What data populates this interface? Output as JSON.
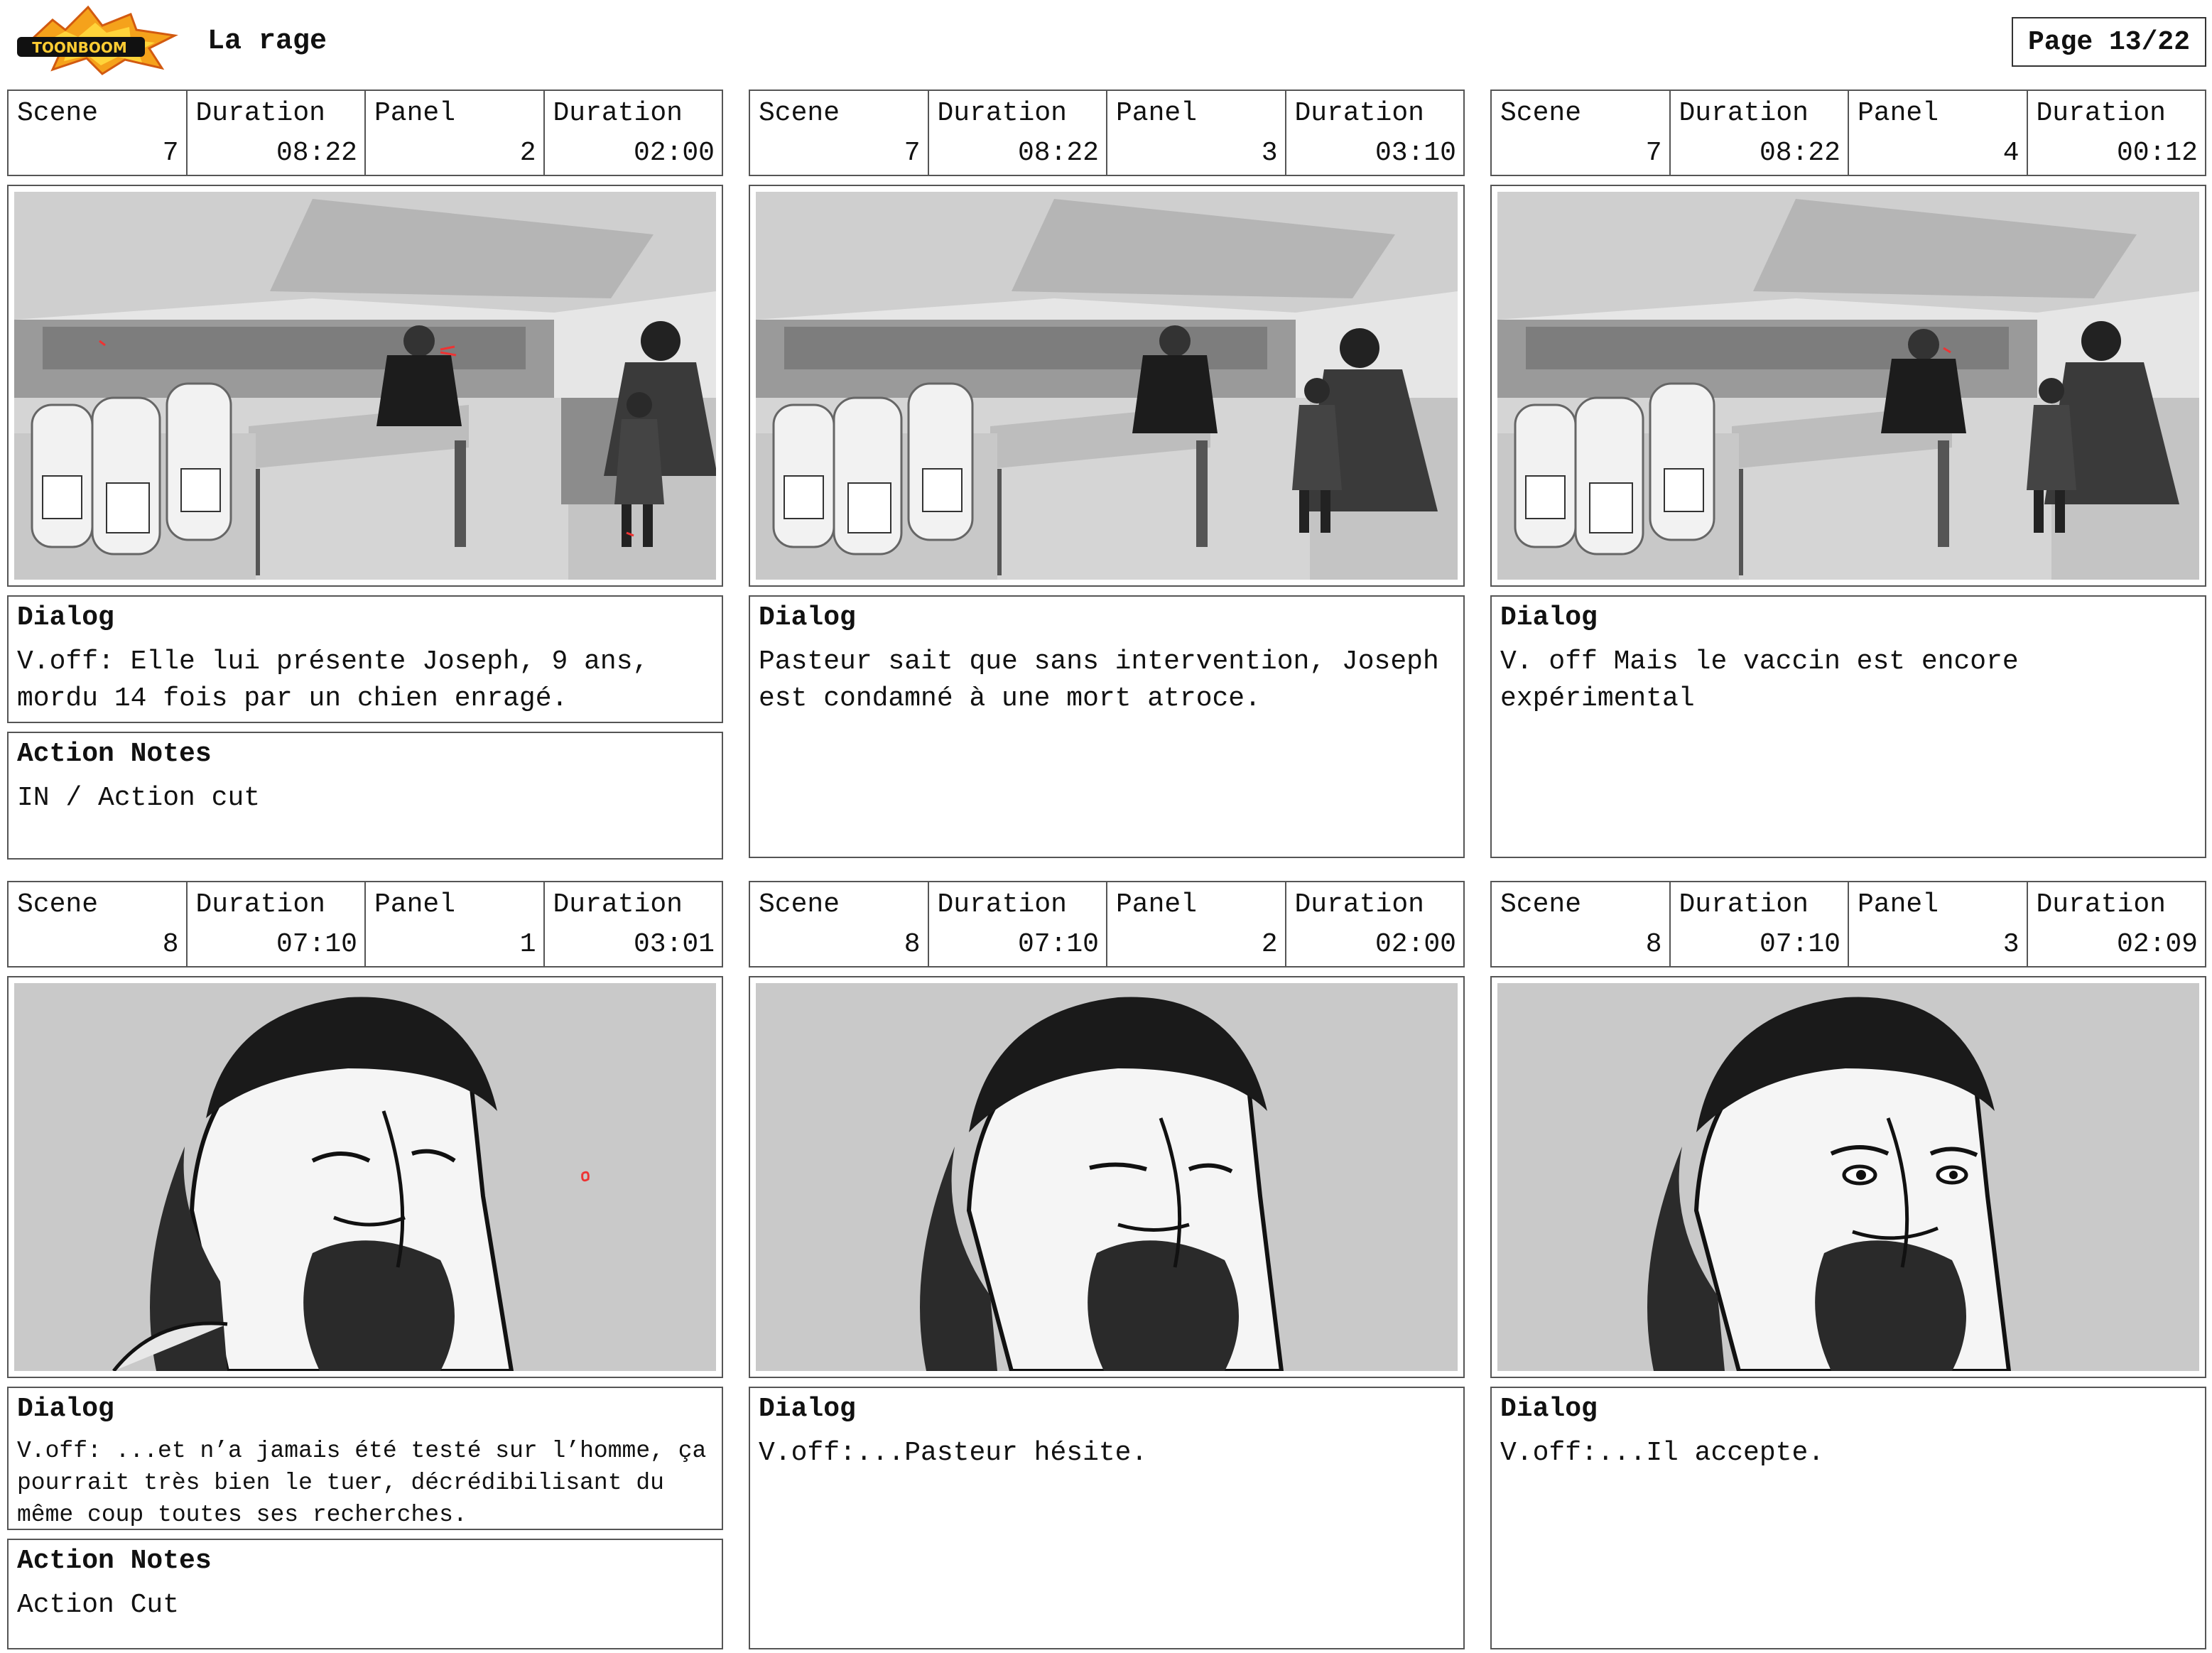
{
  "header": {
    "logo_text": "TOONBOOM",
    "title": "La rage",
    "page_label": "Page 13/22"
  },
  "labels": {
    "scene": "Scene",
    "duration": "Duration",
    "panel": "Panel",
    "dialog": "Dialog",
    "action_notes": "Action Notes"
  },
  "panels": [
    {
      "scene": "7",
      "scene_duration": "08:22",
      "panel": "2",
      "panel_duration": "02:00",
      "dialog": "V.off: Elle lui présente Joseph, 9 ans, mordu 14 fois par un chien enragé.",
      "action_notes": "IN / Action cut"
    },
    {
      "scene": "7",
      "scene_duration": "08:22",
      "panel": "3",
      "panel_duration": "03:10",
      "dialog": "Pasteur sait que sans intervention, Joseph est condamné à une mort atroce."
    },
    {
      "scene": "7",
      "scene_duration": "08:22",
      "panel": "4",
      "panel_duration": "00:12",
      "dialog": "V. off Mais le vaccin est encore expérimental"
    },
    {
      "scene": "8",
      "scene_duration": "07:10",
      "panel": "1",
      "panel_duration": "03:01",
      "dialog": "V.off: ...et n’a jamais été testé sur l’homme, ça pourrait très bien le tuer, décrédibilisant du même coup toutes ses recherches.",
      "action_notes": "Action Cut"
    },
    {
      "scene": "8",
      "scene_duration": "07:10",
      "panel": "2",
      "panel_duration": "02:00",
      "dialog": "V.off:...Pasteur hésite."
    },
    {
      "scene": "8",
      "scene_duration": "07:10",
      "panel": "3",
      "panel_duration": "02:09",
      "dialog": "V.off:...Il accepte."
    }
  ],
  "icons": {
    "logo": "toonboom-logo",
    "lab-scene": "laboratory-sketch",
    "portrait": "pasteur-portrait-sketch"
  }
}
